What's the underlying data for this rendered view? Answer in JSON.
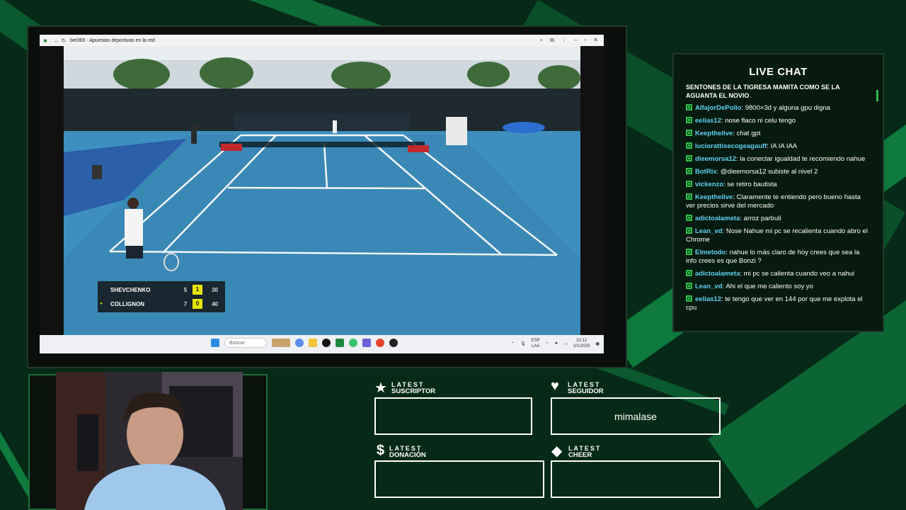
{
  "browser": {
    "title": "bet365 - Apuestas deportivas en la red"
  },
  "scoreboard": {
    "players": [
      {
        "name": "SHEVCHENKO",
        "sets": "5",
        "games": "1",
        "points": "30",
        "serving": false
      },
      {
        "name": "COLLIGNON",
        "sets": "7",
        "games": "0",
        "points": "40",
        "serving": true
      }
    ]
  },
  "taskbar": {
    "search_placeholder": "Buscar",
    "lang_top": "ESP",
    "lang_bottom": "LAA",
    "time": "22:12",
    "date": "2/1/2026"
  },
  "chat": {
    "title": "LIVE CHAT",
    "first_line": "SENTONES DE LA TIGRESA MAMITA COMO SE LA AGUANTA EL NOVIO",
    "messages": [
      {
        "user": "AlfajorDePollo",
        "text": "9800×3d y alguna gpu digna"
      },
      {
        "user": "eelias12",
        "text": "nose flaco ni celu tengo"
      },
      {
        "user": "Keepthelive",
        "text": "chat gpt"
      },
      {
        "user": "luciorattisecogeagauff",
        "text": "IA IA IAA"
      },
      {
        "user": "dieemorsa12",
        "text": "la conectar igualdad te recomiendo nahue"
      },
      {
        "user": "BotRix",
        "text": "@dieemorsa12 subiste al nivel 2"
      },
      {
        "user": "vickenzo",
        "text": "se retiro bautista"
      },
      {
        "user": "Keepthelive",
        "text": "Claramente te entiendo pero bueno hasta ver precios sirve del mercado"
      },
      {
        "user": "adictoalameta",
        "text": "arroz parbuli"
      },
      {
        "user": "Lean_vd",
        "text": "Nose Nahue mi pc se recalienta cuando abro el Chrome"
      },
      {
        "user": "Elmetodo",
        "text": "nahue lo más claro de hoy crees que sea la info crees es que Bonzi ?"
      },
      {
        "user": "adictoalameta",
        "text": "mi pc se calienta cuando veo a nahui"
      },
      {
        "user": "Lean_vd",
        "text": "Ahi el que me caliento soy yo"
      },
      {
        "user": "eelias12",
        "text": "te tengo que ver en 144 por que me explota el cpu"
      }
    ]
  },
  "alerts": {
    "suscriptor": {
      "l1": "LATEST",
      "l2": "SUSCRIPTOR",
      "value": "",
      "icon": "star-icon"
    },
    "seguidor": {
      "l1": "LATEST",
      "l2": "SEGUIDOR",
      "value": "mimalase",
      "icon": "heart-icon"
    },
    "donacion": {
      "l1": "LATEST",
      "l2": "DONACIÓN",
      "value": "",
      "icon": "dollar-icon"
    },
    "cheer": {
      "l1": "LATEST",
      "l2": "CHEER",
      "value": "",
      "icon": "diamond-icon"
    }
  }
}
